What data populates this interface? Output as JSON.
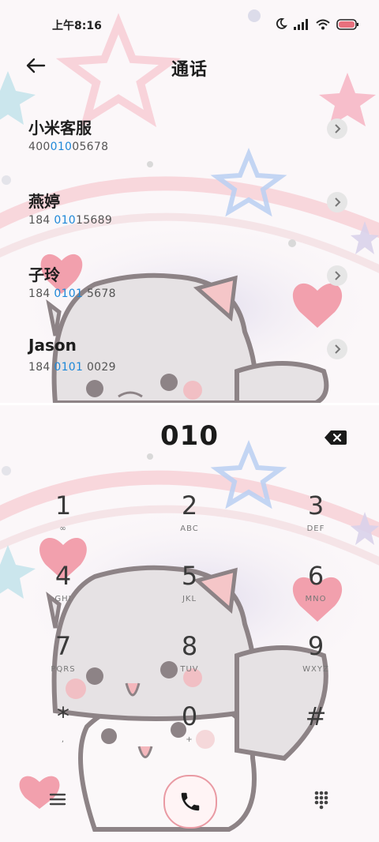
{
  "status": {
    "time": "上午8:16",
    "icons": [
      "moon-icon",
      "signal-icon",
      "wifi-icon",
      "battery-icon"
    ]
  },
  "header": {
    "title": "通话",
    "back_icon": "arrow-left-icon"
  },
  "contacts": [
    {
      "name": "小米客服",
      "number_pre": "400",
      "number_hl": "010",
      "number_post": "05678"
    },
    {
      "name": "燕婷",
      "number_pre": "184 ",
      "number_hl": "010",
      "number_post": "15689"
    },
    {
      "name": "子玲",
      "number_pre": "184 ",
      "number_hl": "0101",
      "number_post": " 5678"
    },
    {
      "name": "Jason",
      "number_pre": "184 ",
      "number_hl": "0101",
      "number_post": " 0029"
    }
  ],
  "dialer": {
    "entered": "010",
    "keys": [
      {
        "digit": "1",
        "letters": "∞"
      },
      {
        "digit": "2",
        "letters": "ABC"
      },
      {
        "digit": "3",
        "letters": "DEF"
      },
      {
        "digit": "4",
        "letters": "GHI"
      },
      {
        "digit": "5",
        "letters": "JKL"
      },
      {
        "digit": "6",
        "letters": "MNO"
      },
      {
        "digit": "7",
        "letters": "PQRS"
      },
      {
        "digit": "8",
        "letters": "TUV"
      },
      {
        "digit": "9",
        "letters": "WXYZ"
      },
      {
        "digit": "*",
        "letters": ","
      },
      {
        "digit": "0",
        "letters": "+"
      },
      {
        "digit": "#",
        "letters": ""
      }
    ]
  },
  "bottom": {
    "menu_icon": "menu-icon",
    "call_icon": "phone-icon",
    "keypad_icon": "dialpad-icon"
  },
  "colors": {
    "highlight": "#1e88d8",
    "accent_pink": "#e99aa3"
  }
}
